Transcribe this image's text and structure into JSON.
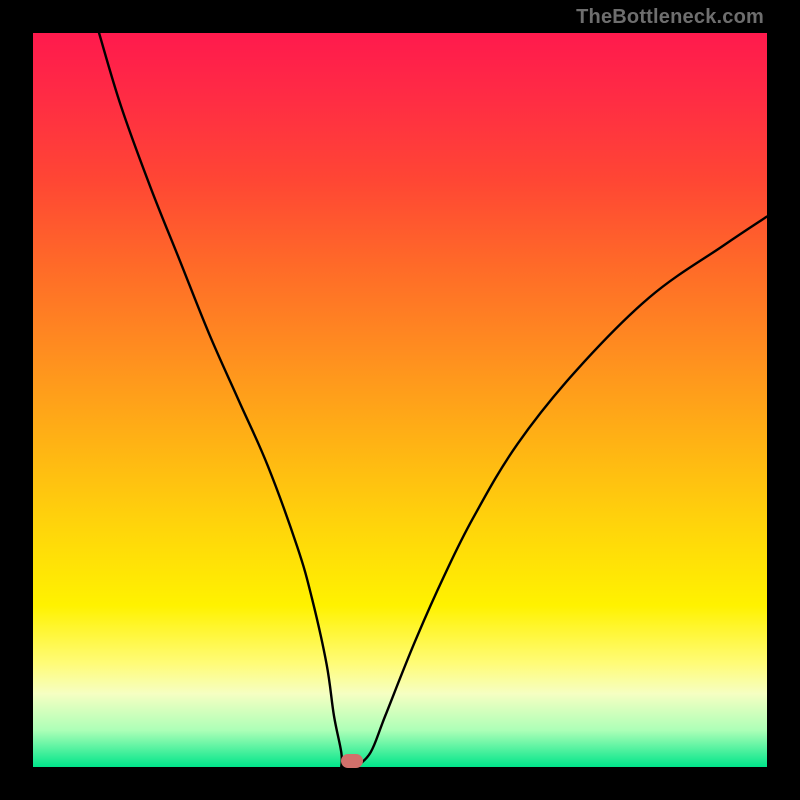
{
  "watermark": "TheBottleneck.com",
  "colors": {
    "frame": "#000000",
    "marker": "#d1706b",
    "curve": "#000000"
  },
  "chart_data": {
    "type": "line",
    "title": "",
    "xlabel": "",
    "ylabel": "",
    "xlim": [
      0,
      100
    ],
    "ylim": [
      0,
      100
    ],
    "series": [
      {
        "name": "bottleneck-curve",
        "x": [
          9,
          12,
          16,
          20,
          24,
          28,
          32,
          36,
          38,
          40,
          41,
          42,
          43,
          44,
          46,
          48,
          52,
          56,
          60,
          66,
          74,
          84,
          94,
          100
        ],
        "values": [
          100,
          90,
          79,
          69,
          59,
          50,
          41,
          30,
          23,
          14,
          7,
          2,
          0,
          0,
          2,
          7,
          17,
          26,
          34,
          44,
          54,
          64,
          71,
          75
        ]
      }
    ],
    "marker": {
      "x": 43.5,
      "y": 0.8
    },
    "flat_bottom": {
      "x_start": 42,
      "x_end": 44,
      "y": 0
    },
    "gradient_stops": [
      {
        "pos": 0,
        "color": "#ff1a4d"
      },
      {
        "pos": 50,
        "color": "#ff9a1a"
      },
      {
        "pos": 80,
        "color": "#fff200"
      },
      {
        "pos": 100,
        "color": "#00e58a"
      }
    ]
  }
}
